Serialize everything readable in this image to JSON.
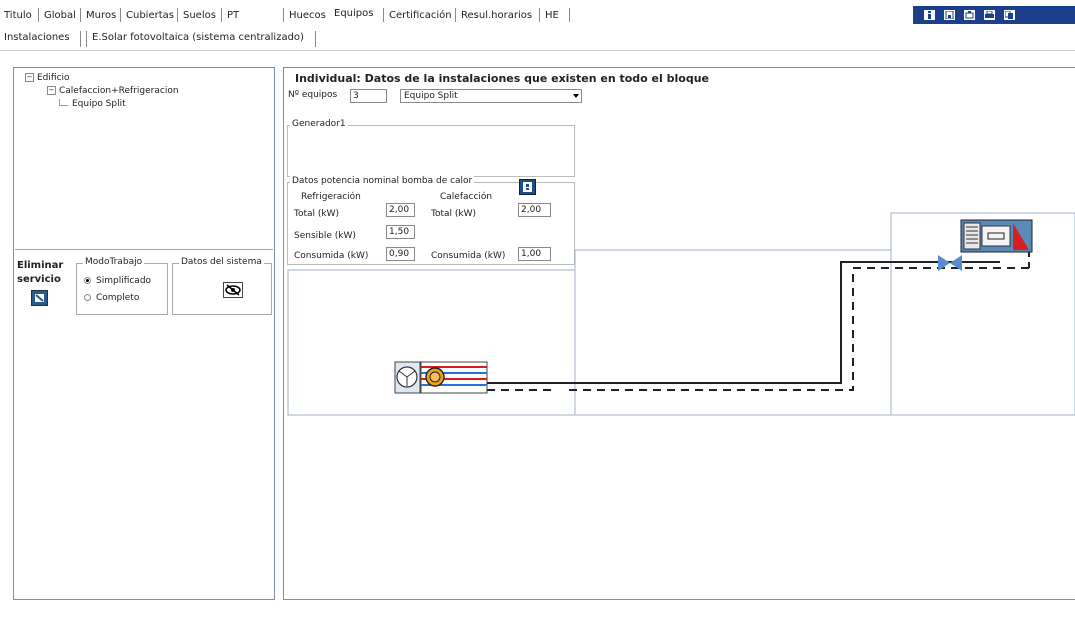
{
  "main_tabs": [
    "Titulo",
    "Global",
    "Muros",
    "Cubiertas",
    "Suelos",
    "PT",
    "Huecos",
    "Equipos",
    "Certificación",
    "Resul.horarios",
    "HE"
  ],
  "active_main_tab": "Equipos",
  "sub_tabs": [
    "Instalaciones",
    "E.Solar fotovoltaica (sistema centralizado)"
  ],
  "toolbar_icons": [
    "info-icon",
    "save-icon",
    "open-icon",
    "print-icon",
    "copy-icon"
  ],
  "tree": {
    "root": "Edificio",
    "child": "Calefaccion+Refrigeracion",
    "leaf": "Equipo Split"
  },
  "left_controls": {
    "eliminar_line1": "Eliminar",
    "eliminar_line2": "servicio",
    "modo_legend": "ModoTrabajo",
    "modo_options": [
      "Simplificado",
      "Completo"
    ],
    "modo_selected": "Simplificado",
    "datos_sistema_legend": "Datos del sistema"
  },
  "main": {
    "title": "Individual: Datos de la instalaciones que existen en todo el bloque",
    "n_equipos_label": "Nº equipos",
    "n_equipos_value": "3",
    "equipo_type": "Equipo Split",
    "generador_legend": "Generador1",
    "potencia_legend": "Datos potencia nominal bomba de calor",
    "refrigeracion_header": "Refrigeración",
    "calefaccion_header": "Calefacción",
    "rows": {
      "total_ref_label": "Total (kW)",
      "total_ref_value": "2,00",
      "total_cal_label": "Total (kW)",
      "total_cal_value": "2,00",
      "sensible_label": "Sensible (kW)",
      "sensible_value": "1,50",
      "consumida_ref_label": "Consumida (kW)",
      "consumida_ref_value": "0,90",
      "consumida_cal_label": "Consumida (kW)",
      "consumida_cal_value": "1,00"
    }
  },
  "colors": {
    "toolbar_bg": "#1b3f8a",
    "panel_border": "#7f8fa8",
    "unit_red": "#d62020",
    "unit_blue": "#2a6fdb"
  }
}
